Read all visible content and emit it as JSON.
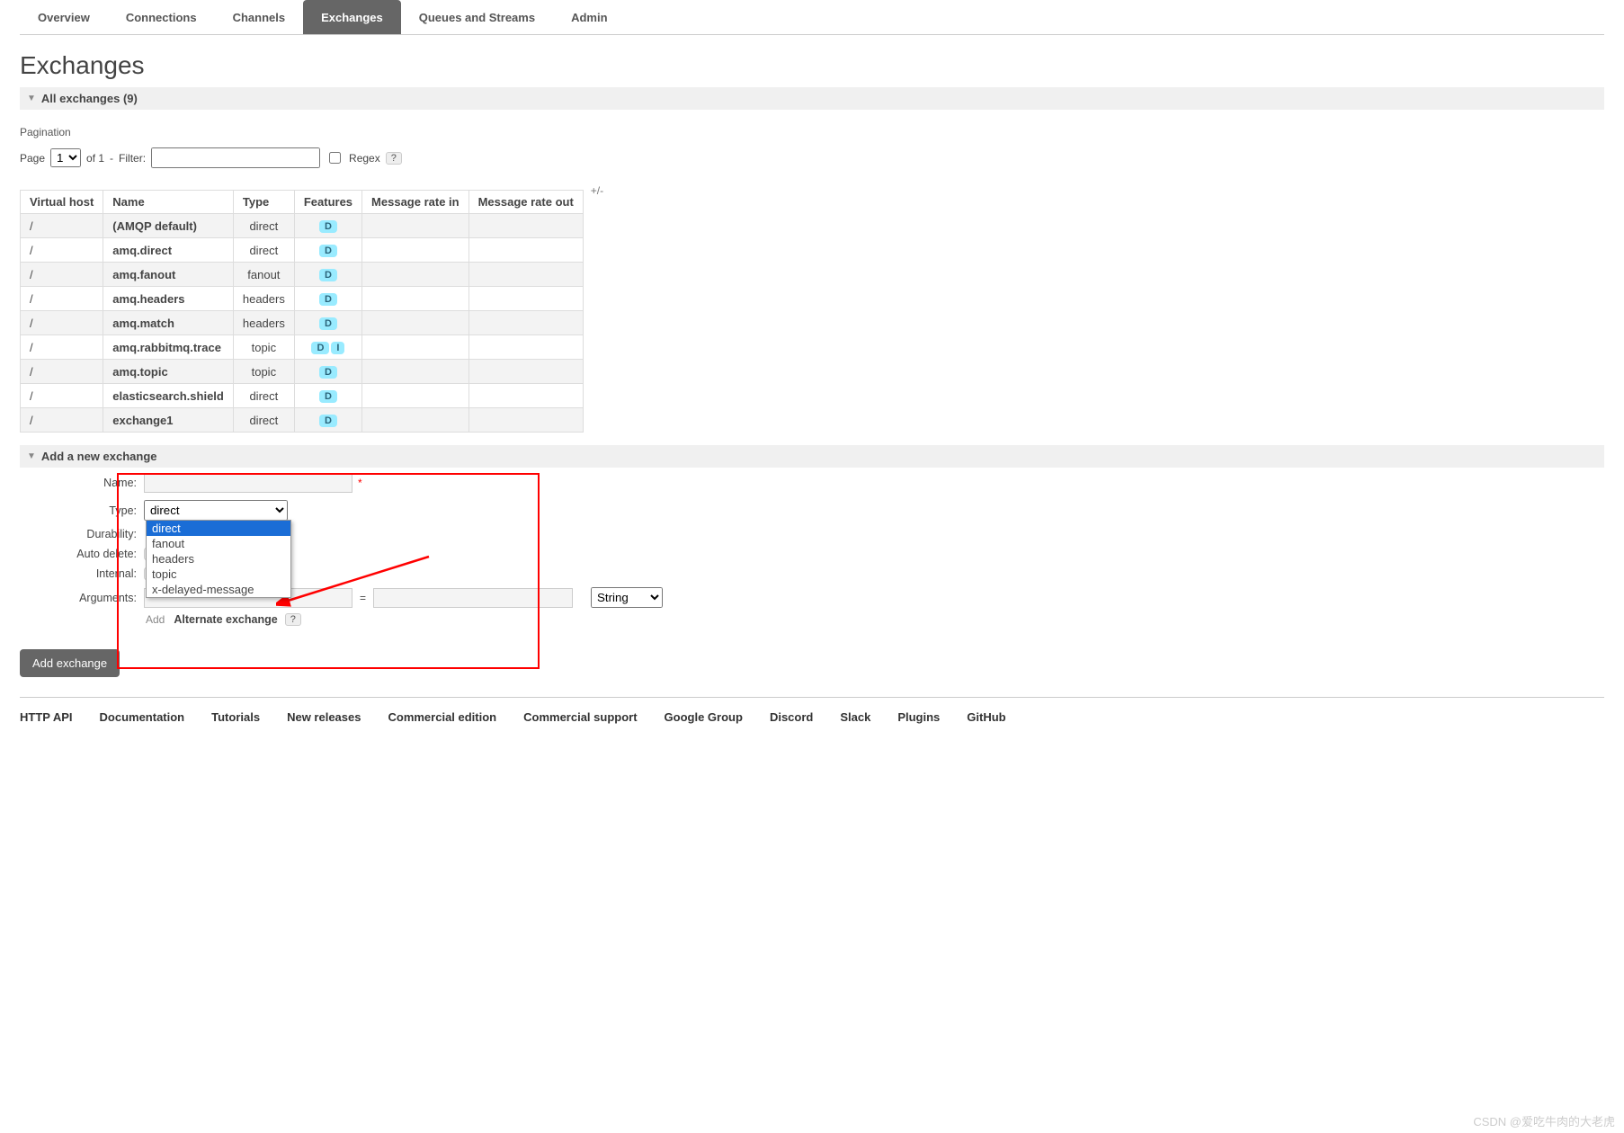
{
  "tabs": [
    "Overview",
    "Connections",
    "Channels",
    "Exchanges",
    "Queues and Streams",
    "Admin"
  ],
  "active_tab": 3,
  "page_title": "Exchanges",
  "section_all": "All exchanges (9)",
  "pagination": {
    "label": "Pagination",
    "page_label": "Page",
    "page_value": "1",
    "of_label": "of 1",
    "dash": "-",
    "filter_label": "Filter:",
    "filter_value": "",
    "regex_label": "Regex",
    "help": "?"
  },
  "table": {
    "headers": [
      "Virtual host",
      "Name",
      "Type",
      "Features",
      "Message rate in",
      "Message rate out"
    ],
    "plusminus": "+/-",
    "rows": [
      {
        "vhost": "/",
        "name": "(AMQP default)",
        "type": "direct",
        "features": [
          "D"
        ]
      },
      {
        "vhost": "/",
        "name": "amq.direct",
        "type": "direct",
        "features": [
          "D"
        ]
      },
      {
        "vhost": "/",
        "name": "amq.fanout",
        "type": "fanout",
        "features": [
          "D"
        ]
      },
      {
        "vhost": "/",
        "name": "amq.headers",
        "type": "headers",
        "features": [
          "D"
        ]
      },
      {
        "vhost": "/",
        "name": "amq.match",
        "type": "headers",
        "features": [
          "D"
        ]
      },
      {
        "vhost": "/",
        "name": "amq.rabbitmq.trace",
        "type": "topic",
        "features": [
          "D",
          "I"
        ]
      },
      {
        "vhost": "/",
        "name": "amq.topic",
        "type": "topic",
        "features": [
          "D"
        ]
      },
      {
        "vhost": "/",
        "name": "elasticsearch.shield",
        "type": "direct",
        "features": [
          "D"
        ]
      },
      {
        "vhost": "/",
        "name": "exchange1",
        "type": "direct",
        "features": [
          "D"
        ]
      }
    ]
  },
  "add_section": "Add a new exchange",
  "form": {
    "name_label": "Name:",
    "name_value": "",
    "required": "*",
    "type_label": "Type:",
    "type_value": "direct",
    "type_options": [
      "direct",
      "fanout",
      "headers",
      "topic",
      "x-delayed-message"
    ],
    "durability_label": "Durability:",
    "autodelete_label": "Auto delete:",
    "internal_label": "Internal:",
    "arguments_label": "Arguments:",
    "arg_key": "",
    "eq": "=",
    "arg_val": "",
    "arg_type": "String",
    "add_link": "Add",
    "alternate": "Alternate exchange",
    "help": "?",
    "submit": "Add exchange"
  },
  "footer": [
    "HTTP API",
    "Documentation",
    "Tutorials",
    "New releases",
    "Commercial edition",
    "Commercial support",
    "Google Group",
    "Discord",
    "Slack",
    "Plugins",
    "GitHub"
  ],
  "watermark": "CSDN @爱吃牛肉的大老虎"
}
